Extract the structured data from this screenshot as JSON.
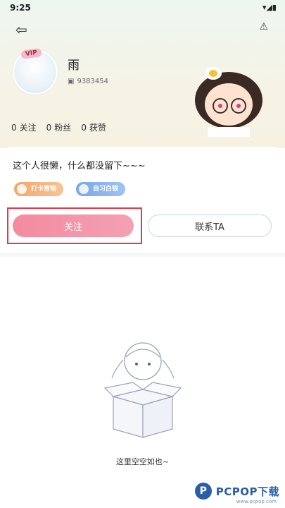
{
  "status_bar": {
    "time": "9:25"
  },
  "profile": {
    "username": "雨",
    "vip_label": "VIP",
    "uid": "9383454",
    "stats": [
      {
        "count": "0",
        "label": "关注"
      },
      {
        "count": "0",
        "label": "粉丝"
      },
      {
        "count": "0",
        "label": "获赞"
      }
    ],
    "bio": "这个人很懒，什么都没留下~~~",
    "badges": [
      "打卡青铜",
      "自习白银"
    ]
  },
  "actions": {
    "follow_label": "关注",
    "contact_label": "联系TA"
  },
  "empty_state": {
    "message": "这里空空如也~"
  },
  "watermark": {
    "logo": "P",
    "text": "PCPOP下载",
    "sub": "www.pcpop.com"
  },
  "colors": {
    "accent_pink": "#f48aa0",
    "highlight_red": "#e53946",
    "watermark_blue": "#2c5ea8"
  }
}
